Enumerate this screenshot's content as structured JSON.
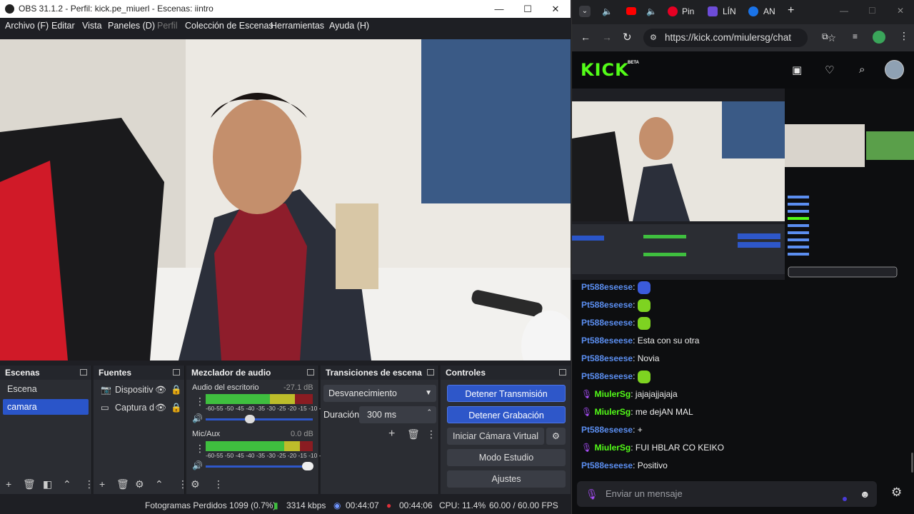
{
  "obs": {
    "title": "OBS 31.1.2 - Perfil: kick.pe_miuerl - Escenas: iintro",
    "menu": [
      "Archivo (F)",
      "Editar",
      "Vista",
      "Paneles (D)",
      "Perfil",
      "Colección de Escenas",
      "Herramientas",
      "Ayuda (H)"
    ],
    "panels": {
      "scenes": {
        "title": "Escenas",
        "items": [
          "Escena",
          "camara"
        ],
        "selected": "camara"
      },
      "sources": {
        "title": "Fuentes",
        "items": [
          "Dispositiv",
          "Captura d"
        ]
      },
      "mixer": {
        "title": "Mezclador de audio",
        "channels": [
          {
            "name": "Audio del escritorio",
            "db": "-27.1 dB"
          },
          {
            "name": "Mic/Aux",
            "db": "0.0 dB"
          }
        ],
        "scale": "-60-55 -50 -45 -40 -35 -30 -25 -20 -15 -10 -5 0"
      },
      "transitions": {
        "title": "Transiciones de escena",
        "transition": "Desvanecimiento",
        "duration_label": "Duración",
        "duration": "300 ms"
      },
      "controls": {
        "title": "Controles",
        "stop_stream": "Detener Transmisión",
        "stop_record": "Detener Grabación",
        "virtual_cam": "Iniciar Cámara Virtual",
        "studio_mode": "Modo Estudio",
        "settings": "Ajustes"
      }
    },
    "status": {
      "dropped": "Fotogramas Perdidos 1099 (0.7%)",
      "bitrate": "3314 kbps",
      "stream_time": "00:44:07",
      "rec_time": "00:44:06",
      "cpu": "CPU: 11.4%",
      "fps": "60.00 / 60.00 FPS"
    }
  },
  "browser": {
    "tabs": [
      "Pin",
      "LÍN",
      "AN"
    ],
    "url": "https://kick.com/miulersg/chat",
    "kick_logo": "KICK",
    "kick_beta": "BETA",
    "chat": [
      {
        "user": "Pt588eseese",
        "text": "",
        "emote": "#3b5bdb",
        "mod": false
      },
      {
        "user": "Pt588eseese",
        "text": "",
        "emote": "#7ed321",
        "mod": false
      },
      {
        "user": "Pt588eseese",
        "text": "",
        "emote": "#7ed321",
        "mod": false
      },
      {
        "user": "Pt588eseese",
        "text": "Esta con su otra",
        "mod": false
      },
      {
        "user": "Pt588eseese",
        "text": "Novia",
        "mod": false
      },
      {
        "user": "Pt588eseese",
        "text": "",
        "emote": "#7ed321",
        "mod": false
      },
      {
        "user": "MiulerSg",
        "text": "jajajajjajaja",
        "mod": true
      },
      {
        "user": "MiulerSg",
        "text": "me dejAN MAL",
        "mod": true
      },
      {
        "user": "Pt588eseese",
        "text": "+",
        "mod": false
      },
      {
        "user": "MiulerSg",
        "text": "FUI HBLAR CO KEIKO",
        "mod": true
      },
      {
        "user": "Pt588eseese",
        "text": "Positivo",
        "mod": false
      }
    ],
    "chat_placeholder": "Enviar un mensaje"
  }
}
